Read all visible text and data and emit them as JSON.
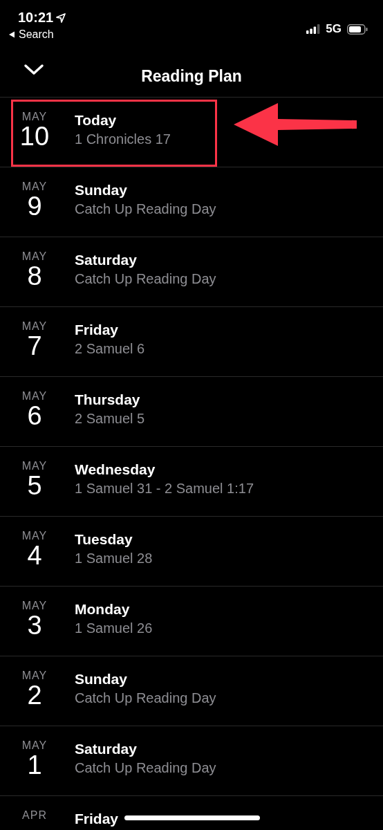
{
  "status_bar": {
    "time": "10:21",
    "back_label": "Search",
    "network": "5G"
  },
  "nav": {
    "title": "Reading Plan"
  },
  "days": [
    {
      "month": "MAY",
      "day": "10",
      "title": "Today",
      "reading": "1 Chronicles 17",
      "highlighted": true
    },
    {
      "month": "MAY",
      "day": "9",
      "title": "Sunday",
      "reading": "Catch Up Reading Day",
      "highlighted": false
    },
    {
      "month": "MAY",
      "day": "8",
      "title": "Saturday",
      "reading": "Catch Up Reading Day",
      "highlighted": false
    },
    {
      "month": "MAY",
      "day": "7",
      "title": "Friday",
      "reading": "2 Samuel 6",
      "highlighted": false
    },
    {
      "month": "MAY",
      "day": "6",
      "title": "Thursday",
      "reading": "2 Samuel 5",
      "highlighted": false
    },
    {
      "month": "MAY",
      "day": "5",
      "title": "Wednesday",
      "reading": "1 Samuel 31 - 2 Samuel 1:17",
      "highlighted": false
    },
    {
      "month": "MAY",
      "day": "4",
      "title": "Tuesday",
      "reading": "1 Samuel 28",
      "highlighted": false
    },
    {
      "month": "MAY",
      "day": "3",
      "title": "Monday",
      "reading": "1 Samuel 26",
      "highlighted": false
    },
    {
      "month": "MAY",
      "day": "2",
      "title": "Sunday",
      "reading": "Catch Up Reading Day",
      "highlighted": false
    },
    {
      "month": "MAY",
      "day": "1",
      "title": "Saturday",
      "reading": "Catch Up Reading Day",
      "highlighted": false
    },
    {
      "month": "APR",
      "title": "Friday",
      "highlighted": false
    }
  ]
}
